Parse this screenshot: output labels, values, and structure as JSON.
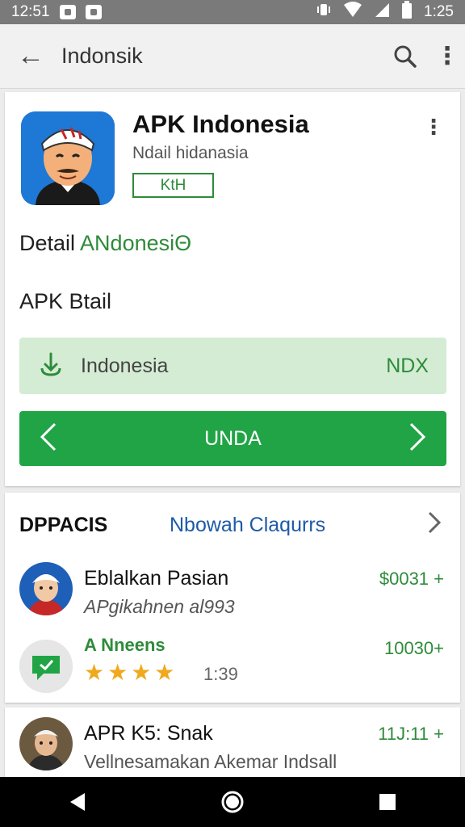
{
  "status": {
    "time_left": "12:51",
    "time_right": "1:25"
  },
  "toolbar": {
    "back_glyph": "←",
    "title": "Indonsik",
    "more_glyph": "⋮"
  },
  "app": {
    "name": "APK Indonesia",
    "subtitle": "Ndail hidanasia",
    "badge": "KtH",
    "detail_prefix": "Detail",
    "detail_green": "ANdonesiΘ",
    "btail": "APK  Btail",
    "install_label": "Indonesia",
    "install_code": "NDX",
    "update_label": "UNDA",
    "brand_color": "#21a446"
  },
  "section": {
    "heading": "DPPACIS",
    "link": "Nbowah Claqurrs",
    "items": [
      {
        "title": "Eblalkan Pasian",
        "subtitle": "APgikahnen al993",
        "price": "$0031 +"
      },
      {
        "tag": "A Nneens",
        "price": "10030+",
        "stars": "★★★★",
        "rating": "1:39"
      }
    ]
  },
  "bottom_item": {
    "title": "APR K5: Snak",
    "subtitle": "Vellnesamakan  Akemar Indsall",
    "price": "11J:11 +"
  }
}
